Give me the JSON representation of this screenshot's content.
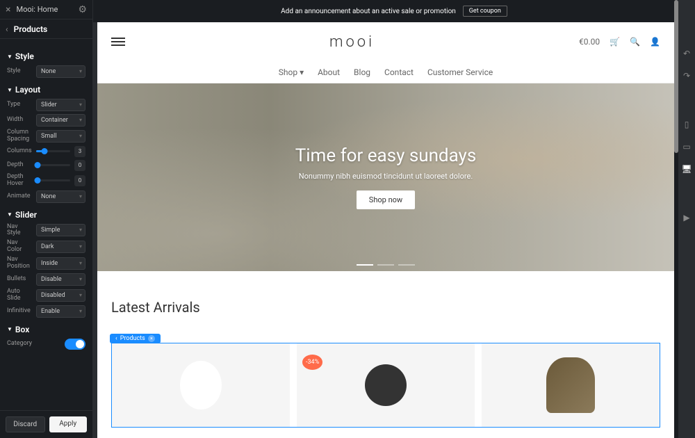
{
  "topbar": {
    "title": "Mooi: Home"
  },
  "breadcrumb": {
    "label": "Products"
  },
  "sections": {
    "style": {
      "title": "Style",
      "style_select": "None"
    },
    "layout": {
      "title": "Layout",
      "type": "Slider",
      "width": "Container",
      "column_spacing": "Small",
      "columns": "3",
      "depth": "0",
      "depth_hover": "0",
      "animate": "None"
    },
    "slider": {
      "title": "Slider",
      "nav_style": "Simple",
      "nav_color": "Dark",
      "nav_position": "Inside",
      "bullets": "Disable",
      "auto_slide": "Disabled",
      "infinitive": "Enable"
    },
    "box": {
      "title": "Box",
      "category": ""
    }
  },
  "labels": {
    "style": "Style",
    "type": "Type",
    "width": "Width",
    "column_spacing": "Column\nSpacing",
    "columns": "Columns",
    "depth": "Depth",
    "depth_hover": "Depth\nHover",
    "animate": "Animate",
    "nav_style": "Nav Style",
    "nav_color": "Nav Color",
    "nav_position": "Nav\nPosition",
    "bullets": "Bullets",
    "auto_slide": "Auto Slide",
    "infinitive": "Infinitive",
    "category": "Category"
  },
  "footer": {
    "discard": "Discard",
    "apply": "Apply"
  },
  "announce": {
    "text": "Add an announcement about an active sale or promotion",
    "coupon": "Get coupon"
  },
  "site": {
    "logo": "mooi",
    "cart_total": "€0.00",
    "nav": [
      "Shop",
      "About",
      "Blog",
      "Contact",
      "Customer Service"
    ],
    "hero": {
      "title": "Time for easy sundays",
      "subtitle": "Nonummy nibh euismod tincidunt ut laoreet dolore.",
      "cta": "Shop now"
    },
    "arrivals": {
      "title": "Latest Arrivals",
      "tag": "Products",
      "badge": "-34%"
    }
  }
}
